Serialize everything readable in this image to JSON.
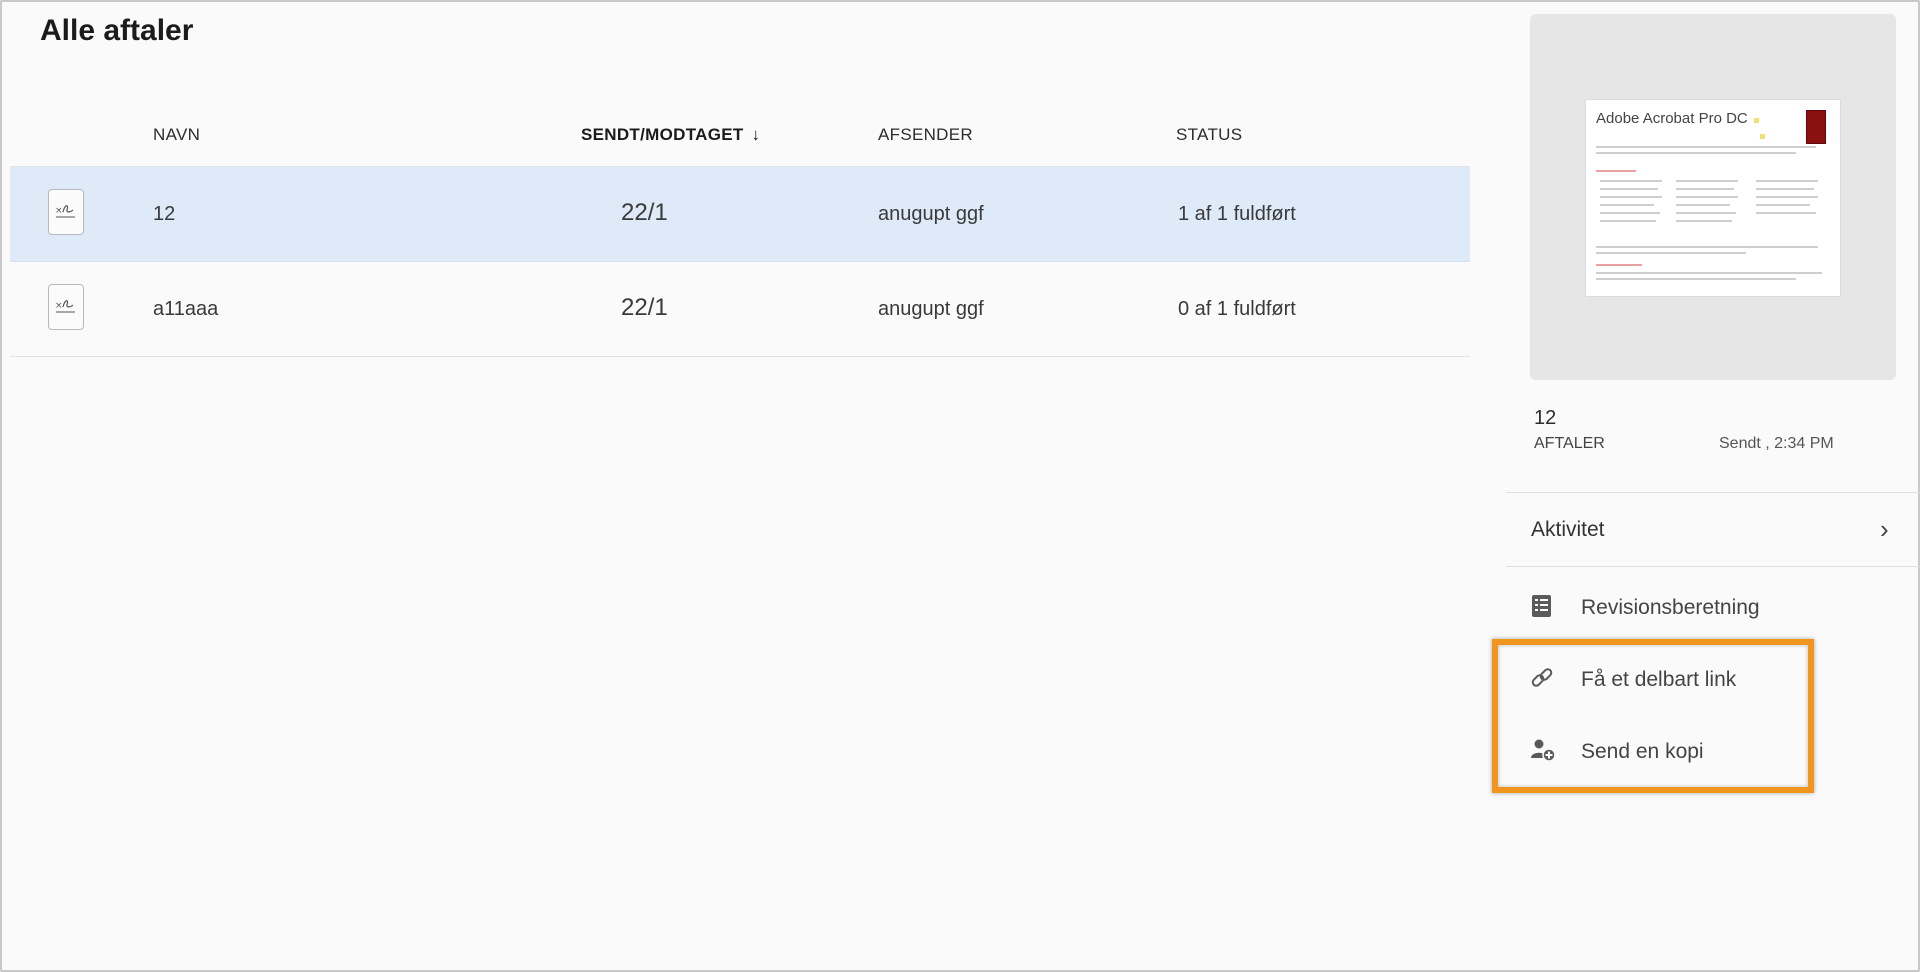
{
  "page": {
    "title": "Alle aftaler"
  },
  "table": {
    "headers": {
      "name": "NAVN",
      "date": "SENDT/MODTAGET",
      "sort_icon": "arrow-down-icon",
      "sender": "AFSENDER",
      "status": "STATUS"
    },
    "rows": [
      {
        "name": "12",
        "date": "22/1",
        "sender": "anugupt ggf",
        "status": "1 af 1 fuldført",
        "selected": true
      },
      {
        "name": "a11aaa",
        "date": "22/1",
        "sender": "anugupt ggf",
        "status": "0 af 1 fuldført",
        "selected": false
      }
    ]
  },
  "preview": {
    "thumbnail_title": "Adobe Acrobat Pro DC",
    "doc_name": "12",
    "doc_type": "AFTALER",
    "sent": "Sendt , 2:34 PM"
  },
  "panel": {
    "activity_label": "Aktivitet",
    "actions": [
      {
        "label": "Revisionsberetning",
        "icon": "audit-report-icon"
      },
      {
        "label": "Få et delbart link",
        "icon": "link-icon"
      },
      {
        "label": "Send en kopi",
        "icon": "add-user-icon"
      }
    ]
  },
  "colors": {
    "selected_row": "#deeaf8",
    "highlight_border": "#f0961e"
  }
}
